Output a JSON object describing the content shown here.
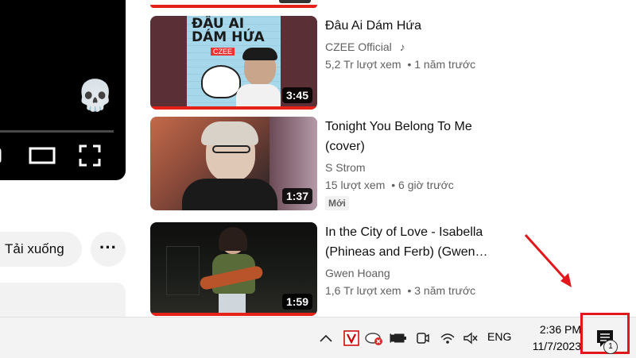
{
  "player": {
    "skull_emoji": "💀"
  },
  "actions": {
    "download_label": "Tải xuống",
    "more_label": "···"
  },
  "videos": [
    {
      "title": "Đâu Ai Dám Hứa",
      "channel": "CZEE Official",
      "channel_badge": "♪",
      "views": "5,2 Tr lượt xem",
      "age": "• 1 năm trước",
      "duration": "3:45",
      "thumb_text": "ĐÂU AI DÁM HỨA",
      "thumb_sub": "CZEE"
    },
    {
      "title": "Tonight You Belong To Me (cover)",
      "channel": "S Strom",
      "views": "15 lượt xem",
      "age": "• 6 giờ trước",
      "badge": "Mới",
      "duration": "1:37"
    },
    {
      "title": "In the City of Love - Isabella (Phineas and Ferb) (Gwen…",
      "channel": "Gwen Hoang",
      "views": "1,6 Tr lượt xem",
      "age": "• 3 năm trước",
      "duration": "1:59"
    }
  ],
  "taskbar": {
    "language": "ENG",
    "time": "2:36 PM",
    "date": "11/7/2023",
    "notification_count": "1"
  },
  "colors": {
    "accent_red": "#e62117",
    "annotation_red": "#e3161b"
  }
}
